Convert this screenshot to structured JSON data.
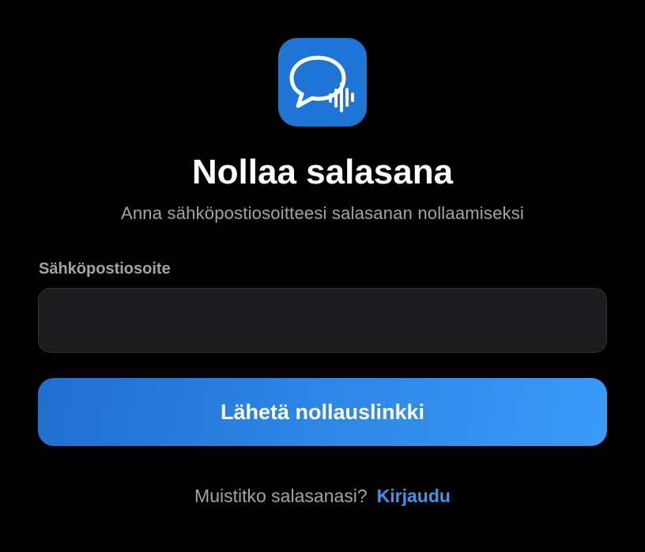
{
  "logo": {
    "icon": "chat-bubble-voice-icon",
    "background_color": "#1f75d6"
  },
  "header": {
    "title": "Nollaa salasana",
    "subtitle": "Anna sähköpostiosoitteesi salasanan nollaamiseksi"
  },
  "form": {
    "email_label": "Sähköpostiosoite",
    "email_value": "",
    "email_placeholder": "",
    "submit_label": "Lähetä nollauslinkki"
  },
  "footer": {
    "prompt": "Muistitko salasanasi?",
    "link_label": "Kirjaudu"
  },
  "colors": {
    "background": "#000000",
    "accent": "#3a97ee",
    "button_gradient_start": "#1f6fcf",
    "button_gradient_end": "#3a9af7",
    "muted_text": "#a3a3a8",
    "input_background": "#1c1c1e"
  }
}
